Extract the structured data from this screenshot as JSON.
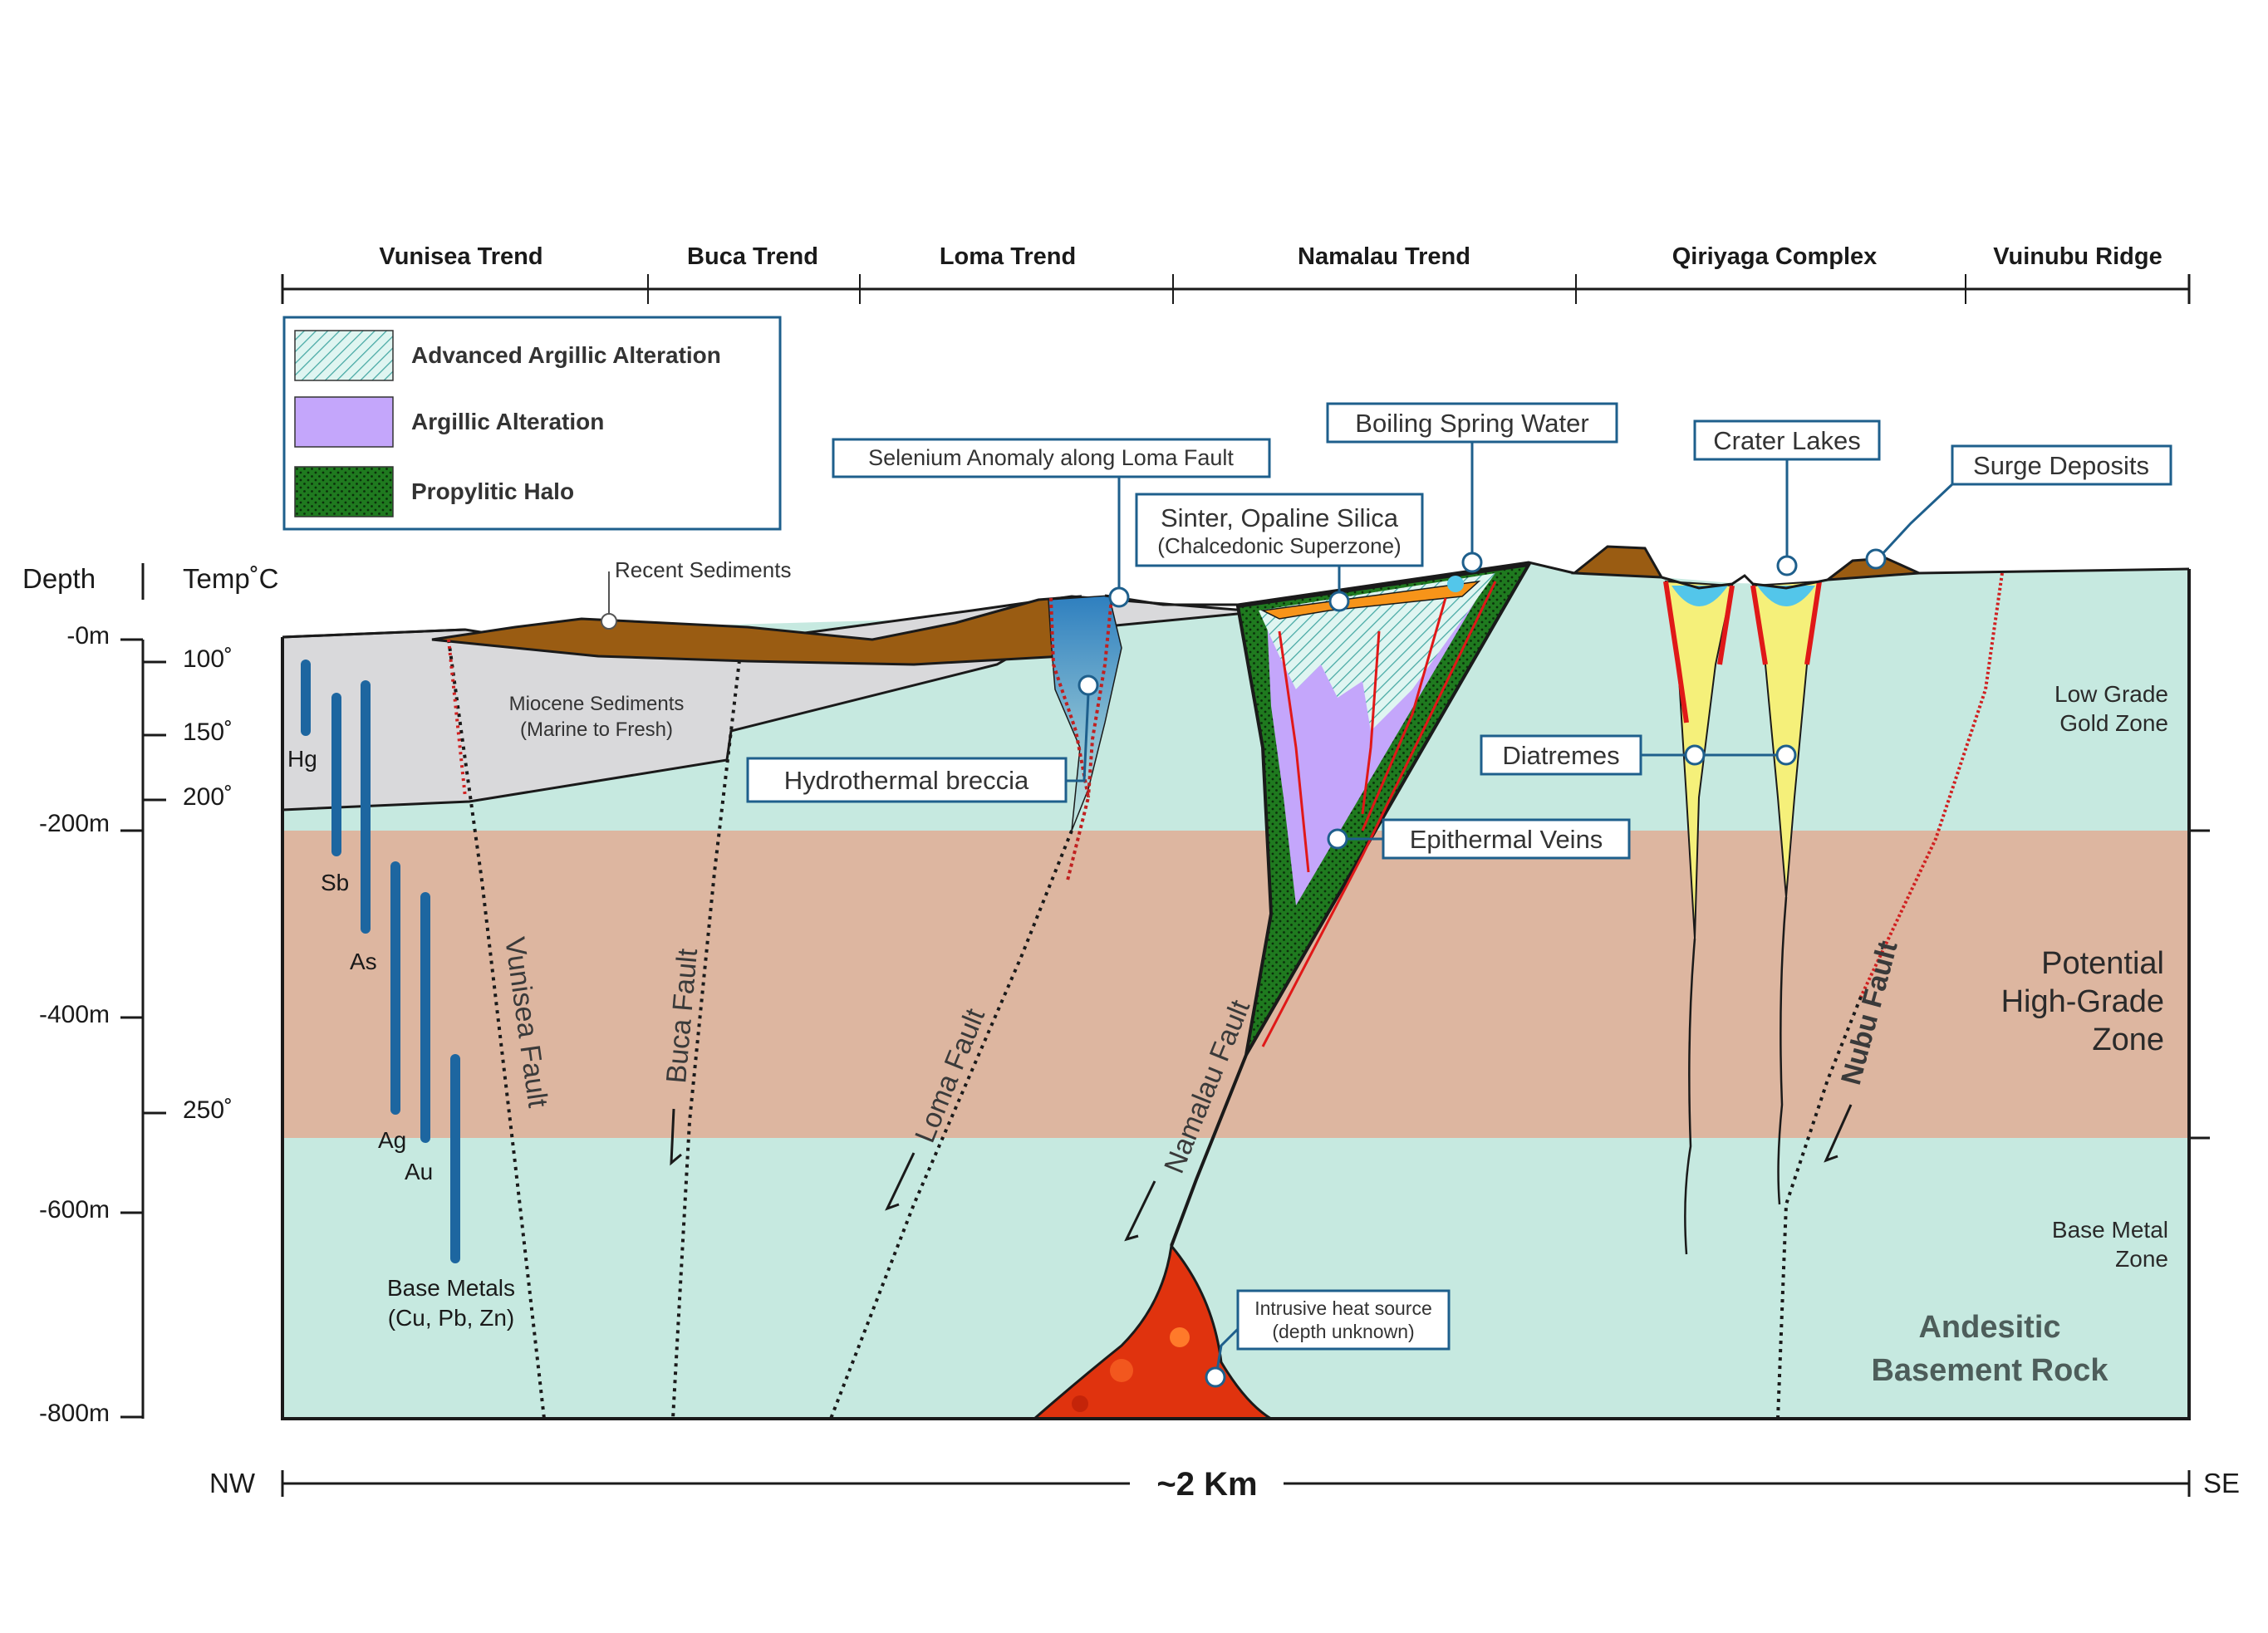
{
  "trends": [
    "Vunisea Trend",
    "Buca Trend",
    "Loma Trend",
    "Namalau Trend",
    "Qiriyaga Complex",
    "Vuinubu Ridge"
  ],
  "legend": {
    "items": [
      {
        "label": "Advanced Argillic Alteration",
        "pattern": "hatch-cyan",
        "color": "#bfece6"
      },
      {
        "label": "Argillic Alteration",
        "pattern": "solid",
        "color": "#c4a6fb"
      },
      {
        "label": "Propylitic Halo",
        "pattern": "dots-green",
        "color": "#1f7a1f"
      }
    ]
  },
  "axis": {
    "depth_title": "Depth",
    "temp_title": "Temp˚C",
    "depth_ticks": [
      "-0m",
      "-200m",
      "-400m",
      "-600m",
      "-800m"
    ],
    "temp_ticks": [
      "100˚",
      "150˚",
      "200˚",
      "250˚"
    ]
  },
  "metals": [
    "Hg",
    "Sb",
    "As",
    "Ag",
    "Au",
    "Base Metals",
    "(Cu, Pb, Zn)"
  ],
  "sediments": {
    "recent": "Recent Sediments",
    "miocene": "Miocene Sediments",
    "miocene_sub": "(Marine to Fresh)"
  },
  "callouts": {
    "selenium": "Selenium Anomaly along Loma Fault",
    "sinter": "Sinter, Opaline Silica",
    "sinter_sub": "(Chalcedonic Superzone)",
    "boiling": "Boiling Spring Water",
    "crater": "Crater Lakes",
    "surge": "Surge Deposits",
    "breccia": "Hydrothermal breccia",
    "diatremes": "Diatremes",
    "veins": "Epithermal Veins",
    "intrusive": "Intrusive heat source",
    "intrusive_sub": "(depth unknown)"
  },
  "faults": [
    "Vunisea Fault",
    "Buca Fault",
    "Loma Fault",
    "Namalau Fault",
    "Nubu Fault"
  ],
  "zones": {
    "low_grade_1": "Low Grade",
    "low_grade_2": "Gold Zone",
    "potential_1": "Potential",
    "potential_2": "High-Grade",
    "potential_3": "Zone",
    "base_metal_1": "Base Metal",
    "base_metal_2": "Zone",
    "basement_1": "Andesitic",
    "basement_2": "Basement Rock"
  },
  "scale": {
    "left": "NW",
    "center": "~2 Km",
    "right": "SE"
  },
  "colors": {
    "basement": "#c6e9e0",
    "high_grade_band": "#deb19a",
    "miocene": "#d9d9db",
    "recent": "#9a5c12",
    "sinter": "#f79419",
    "diatreme": "#f5f07a",
    "lake": "#53c6ea",
    "intrusion": "#e0330e",
    "callout_border": "#1e5f8c",
    "metal_bar": "#1d66a0"
  }
}
